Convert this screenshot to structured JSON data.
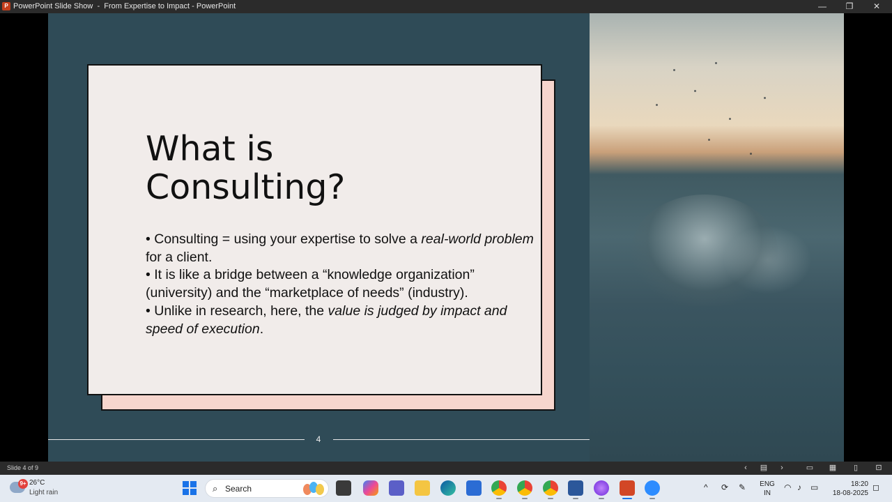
{
  "window": {
    "app_logo_letter": "P",
    "title": "PowerPoint Slide Show  -  From Expertise to Impact - PowerPoint",
    "minimize": "—",
    "restore": "❐",
    "close": "✕"
  },
  "slide": {
    "title_line1": "What is",
    "title_line2": "Consulting?",
    "bullets": [
      {
        "plain": "• Consulting = using your expertise to solve a ",
        "italic": "real-world problem",
        "tail": " for a client."
      },
      {
        "plain": "• It is like a bridge between a “knowledge organization” (university) and the “marketplace of needs” (industry).",
        "italic": "",
        "tail": ""
      },
      {
        "plain": "• Unlike in research, here, the ",
        "italic": "value is judged by impact and speed of execution",
        "tail": "."
      }
    ],
    "page_number": "4",
    "background_color": "#2f4b57",
    "card_color": "#f1ecea",
    "shadow_card_color": "#f6d5cd"
  },
  "statusbar": {
    "slide_count": "Slide 4 of 9",
    "icons": [
      "prev-icon",
      "slide-sorter-icon",
      "next-icon",
      "normal-view-icon",
      "grid-view-icon",
      "reading-view-icon",
      "presenter-icon"
    ]
  },
  "taskbar": {
    "weather": {
      "badge": "9+",
      "temp": "26°C",
      "condition": "Light rain"
    },
    "search_placeholder": "Search",
    "apps": [
      "file-explorer-dark-icon",
      "copilot-icon",
      "teams-icon",
      "folder-icon",
      "edge-icon",
      "store-icon",
      "chrome-icon",
      "chrome-a-icon",
      "chrome-b-icon",
      "word-icon",
      "arc-icon",
      "powerpoint-icon",
      "zoom-icon"
    ],
    "lang_line1": "ENG",
    "lang_line2": "IN",
    "time": "18:20",
    "date": "18-08-2025"
  }
}
